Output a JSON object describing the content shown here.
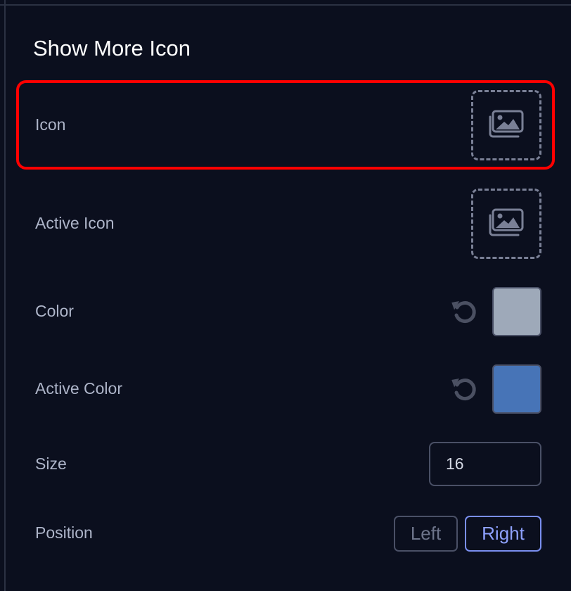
{
  "section": {
    "title": "Show More Icon"
  },
  "rows": {
    "icon": {
      "label": "Icon",
      "picker_icon": "image-gallery-icon"
    },
    "active_icon": {
      "label": "Active Icon",
      "picker_icon": "image-gallery-icon"
    },
    "color": {
      "label": "Color",
      "value": "#9ea9b9",
      "reset_icon": "reset-icon"
    },
    "active_color": {
      "label": "Active Color",
      "value": "#4774b7",
      "reset_icon": "reset-icon"
    },
    "size": {
      "label": "Size",
      "value": "16"
    },
    "position": {
      "label": "Position",
      "options": [
        "Left",
        "Right"
      ],
      "selected": "Right"
    }
  },
  "colors": {
    "background": "#0b0f1e",
    "highlight": "#ff0000",
    "accent": "#8ea1ff"
  }
}
